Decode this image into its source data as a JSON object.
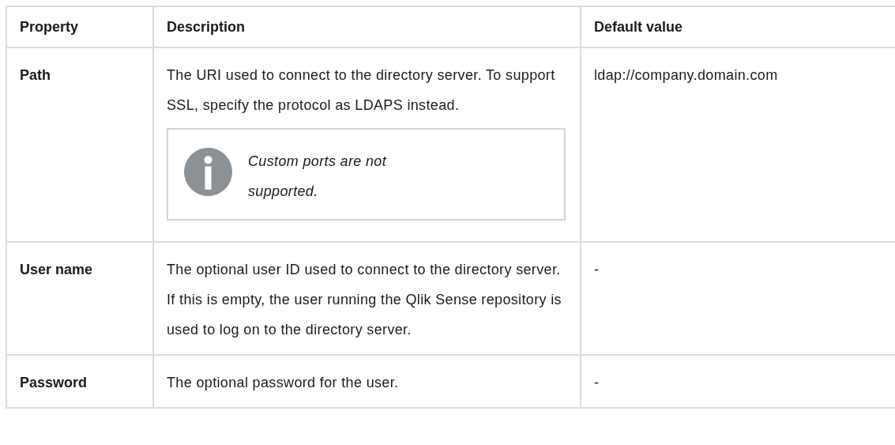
{
  "table": {
    "columns": [
      "Property",
      "Description",
      "Default value"
    ],
    "rows": [
      {
        "property": "Path",
        "description": "The URI used to connect to the directory server. To support SSL, specify the protocol as LDAPS instead.",
        "note": {
          "kind": "info",
          "text": "Custom ports are not supported."
        },
        "default": "ldap://company.domain.com"
      },
      {
        "property": "User name",
        "description": "The optional user ID used to connect to the directory server. If this is empty, the user running the Qlik Sense repository is used to log on to the directory server.",
        "default": "-"
      },
      {
        "property": "Password",
        "description": "The optional password for the user.",
        "default": "-"
      }
    ]
  }
}
